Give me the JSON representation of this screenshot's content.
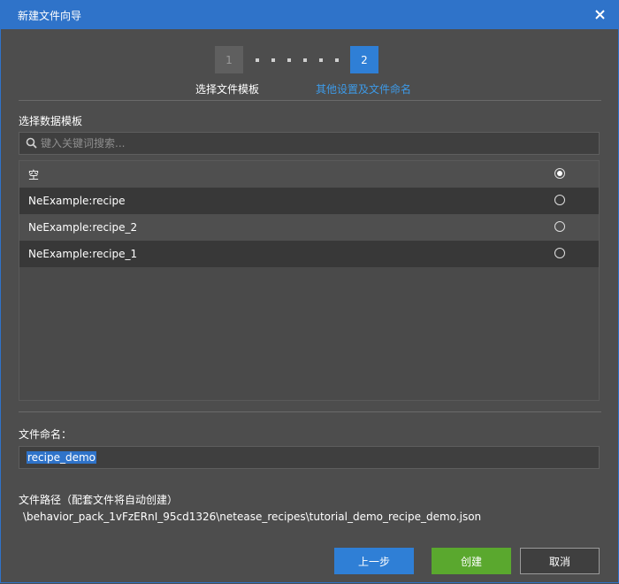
{
  "window": {
    "title": "新建文件向导"
  },
  "stepper": {
    "step1_number": "1",
    "step2_number": "2",
    "step1_label": "选择文件模板",
    "step2_label": "其他设置及文件命名"
  },
  "template_section": {
    "label": "选择数据模板",
    "search_placeholder": "键入关键词搜索...",
    "items": [
      {
        "label": "空",
        "selected": true
      },
      {
        "label": "NeExample:recipe",
        "selected": false
      },
      {
        "label": "NeExample:recipe_2",
        "selected": false
      },
      {
        "label": "NeExample:recipe_1",
        "selected": false
      }
    ]
  },
  "filename_section": {
    "label": "文件命名：",
    "value": "recipe_demo"
  },
  "path_section": {
    "label": "文件路径（配套文件将自动创建）",
    "path": "\\behavior_pack_1vFzERnI_95cd1326\\netease_recipes\\tutorial_demo_recipe_demo.json"
  },
  "buttons": {
    "prev": "上一步",
    "create": "创建",
    "cancel": "取消"
  },
  "colors": {
    "accent": "#2f73c9",
    "create_button": "#5aa82e",
    "background": "#4d4d4d"
  }
}
